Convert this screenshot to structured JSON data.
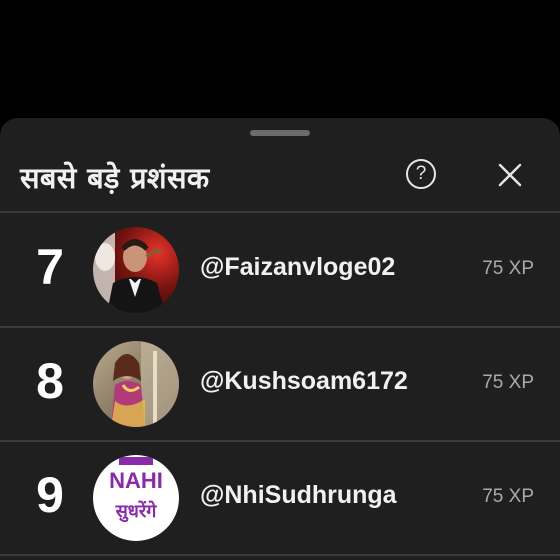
{
  "sheet": {
    "title": "सबसे बड़े प्रशंसक",
    "help_symbol": "?"
  },
  "leaderboard": [
    {
      "rank": "7",
      "handle": "@Faizanvloge02",
      "xp": "75 XP",
      "avatar": "man-in-tuxedo-photo"
    },
    {
      "rank": "8",
      "handle": "@Kushsoam6172",
      "xp": "75 XP",
      "avatar": "woman-in-saree-photo"
    },
    {
      "rank": "9",
      "handle": "@NhiSudhrunga",
      "xp": "75 XP",
      "avatar": "nahi-sudharenge-text-logo"
    }
  ],
  "avatar_text": {
    "top": "NAHI",
    "bottom": "सुधरेंगे"
  },
  "colors": {
    "background": "#000000",
    "sheet": "#1f1f1f",
    "divider": "#3a3a3a",
    "text_primary": "#f1f1f1",
    "text_secondary": "#aaaaaa",
    "logo_purple": "#8a2aa8"
  }
}
